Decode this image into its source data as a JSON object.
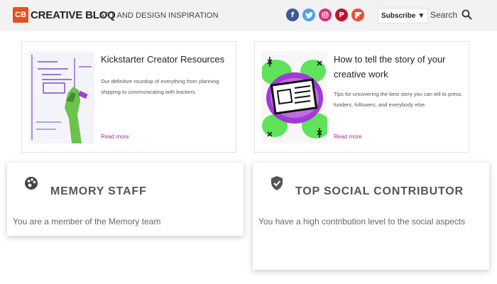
{
  "header": {
    "logo_mark": "CB",
    "logo_text": "CREATIVE BLOQ",
    "tagline": "ART AND DESIGN INSPIRATION",
    "socials": [
      {
        "name": "facebook",
        "glyph": "f"
      },
      {
        "name": "twitter",
        "glyph": "t"
      },
      {
        "name": "instagram",
        "glyph": "◎"
      },
      {
        "name": "pinterest",
        "glyph": "P"
      },
      {
        "name": "flipboard",
        "glyph": "F"
      }
    ],
    "subscribe_label": "Subscribe",
    "search_label": "Search"
  },
  "articles": [
    {
      "title": "Kickstarter Creator Resources",
      "description": "Our definitive roundup of everything from planning shipping to communicating with backers.",
      "read_more": "Read more"
    },
    {
      "title": "How to tell the story of your creative work",
      "description": "Tips for uncovering the best story you can tell to press, funders, followers, and everybody else.",
      "read_more": "Read more"
    }
  ],
  "badges": [
    {
      "icon": "palette-icon",
      "title": "MEMORY STAFF",
      "description": "You are a member of the Memory team"
    },
    {
      "icon": "shield-check-icon",
      "title": "TOP SOCIAL CONTRIBUTOR",
      "description": "You have a high contribution level to the social aspects"
    }
  ],
  "colors": {
    "brand": "#e85020",
    "link": "#a0348c",
    "header_bg": "#f2f2f2"
  }
}
